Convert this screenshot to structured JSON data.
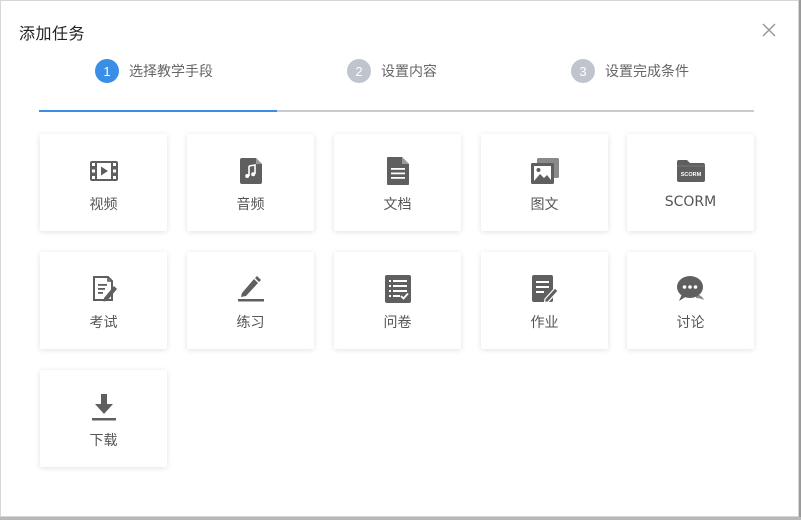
{
  "dialog": {
    "title": "添加任务",
    "close_icon": "close-icon"
  },
  "steps": [
    {
      "number": "1",
      "label": "选择教学手段",
      "active": true
    },
    {
      "number": "2",
      "label": "设置内容",
      "active": false
    },
    {
      "number": "3",
      "label": "设置完成条件",
      "active": false
    }
  ],
  "progress": {
    "fraction": 0.333,
    "active_color": "#3a8ee6",
    "track_color": "#c8cbd0"
  },
  "task_types": [
    {
      "label": "视频",
      "icon": "video-icon"
    },
    {
      "label": "音频",
      "icon": "audio-icon"
    },
    {
      "label": "文档",
      "icon": "document-icon"
    },
    {
      "label": "图文",
      "icon": "image-text-icon"
    },
    {
      "label": "SCORM",
      "icon": "scorm-folder-icon"
    },
    {
      "label": "考试",
      "icon": "exam-icon"
    },
    {
      "label": "练习",
      "icon": "practice-icon"
    },
    {
      "label": "问卷",
      "icon": "questionnaire-icon"
    },
    {
      "label": "作业",
      "icon": "homework-icon"
    },
    {
      "label": "讨论",
      "icon": "discussion-icon"
    },
    {
      "label": "下载",
      "icon": "download-icon"
    }
  ],
  "scorm_icon_text": "SCORM"
}
